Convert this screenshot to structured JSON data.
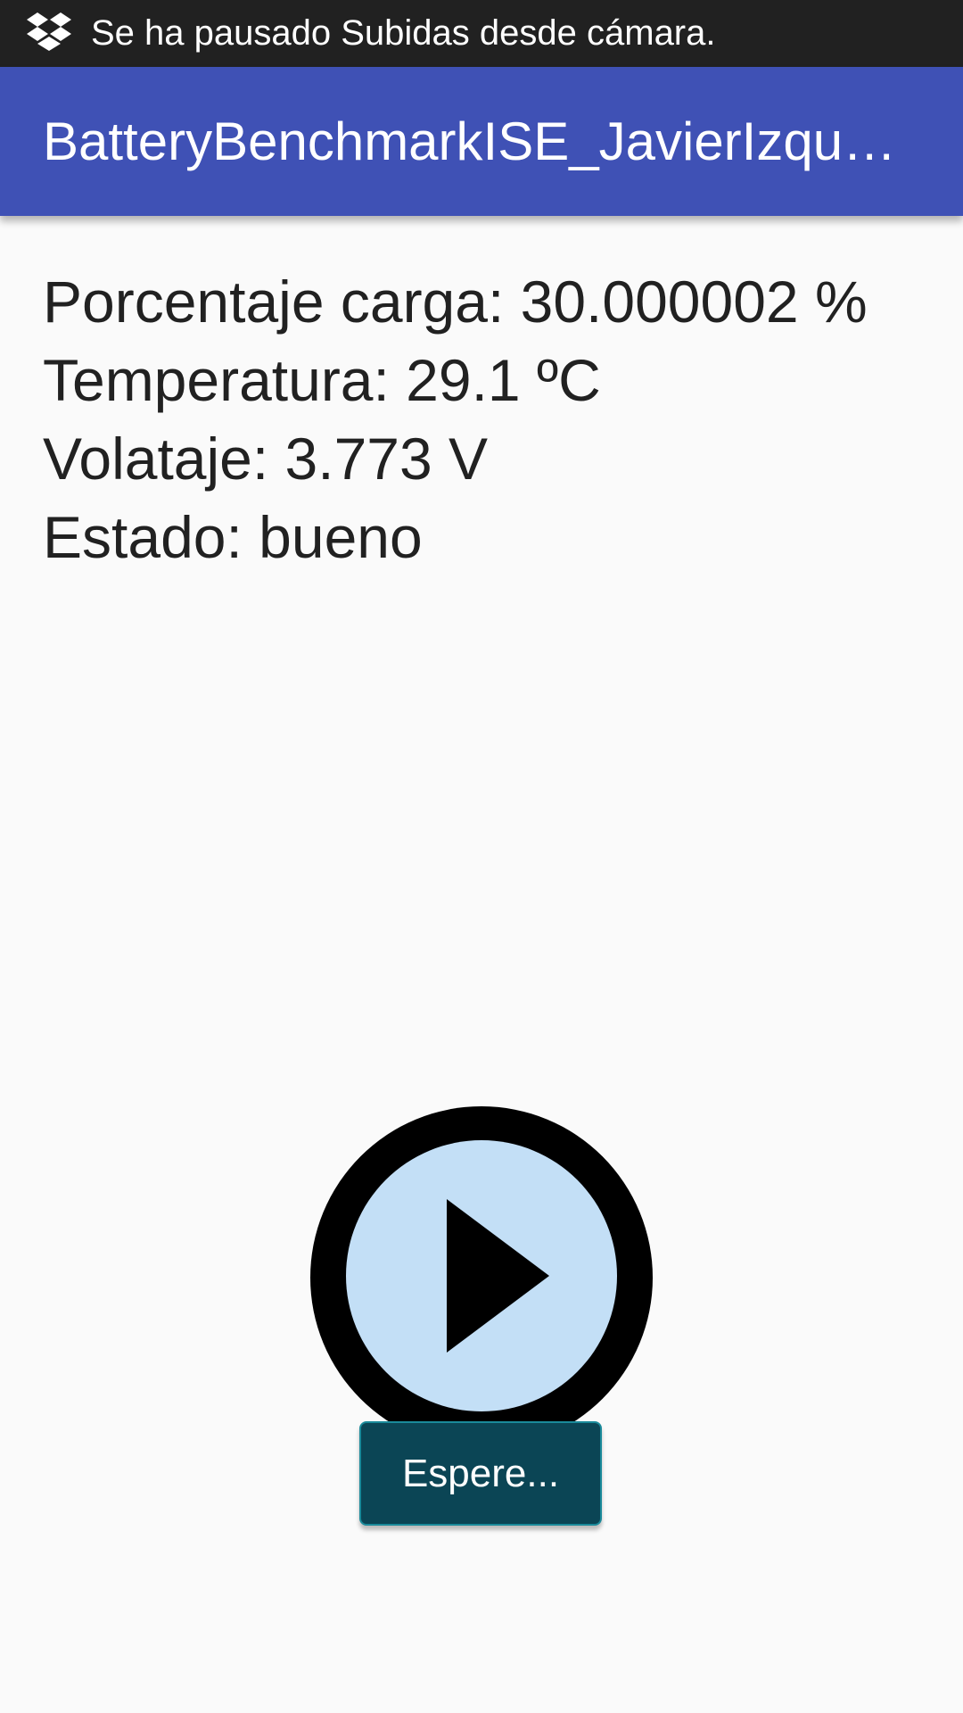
{
  "status_bar": {
    "notification_icon": "dropbox-icon",
    "notification_text": "Se ha pausado Subidas desde cámara."
  },
  "app_bar": {
    "title": "BatteryBenchmarkISE_JavierIzquierdo",
    "color": "#3f51b5"
  },
  "stats": {
    "charge": "Porcentaje carga:  30.000002 %",
    "temperature": "Temperatura:  29.1 ºC",
    "voltage": "Volataje: 3.773 V",
    "state": "Estado:  bueno"
  },
  "controls": {
    "play_icon": "play-icon",
    "play_fill_color": "#c3dff6",
    "wait_button_label": "Espere...",
    "wait_button_color": "#0b4555"
  }
}
